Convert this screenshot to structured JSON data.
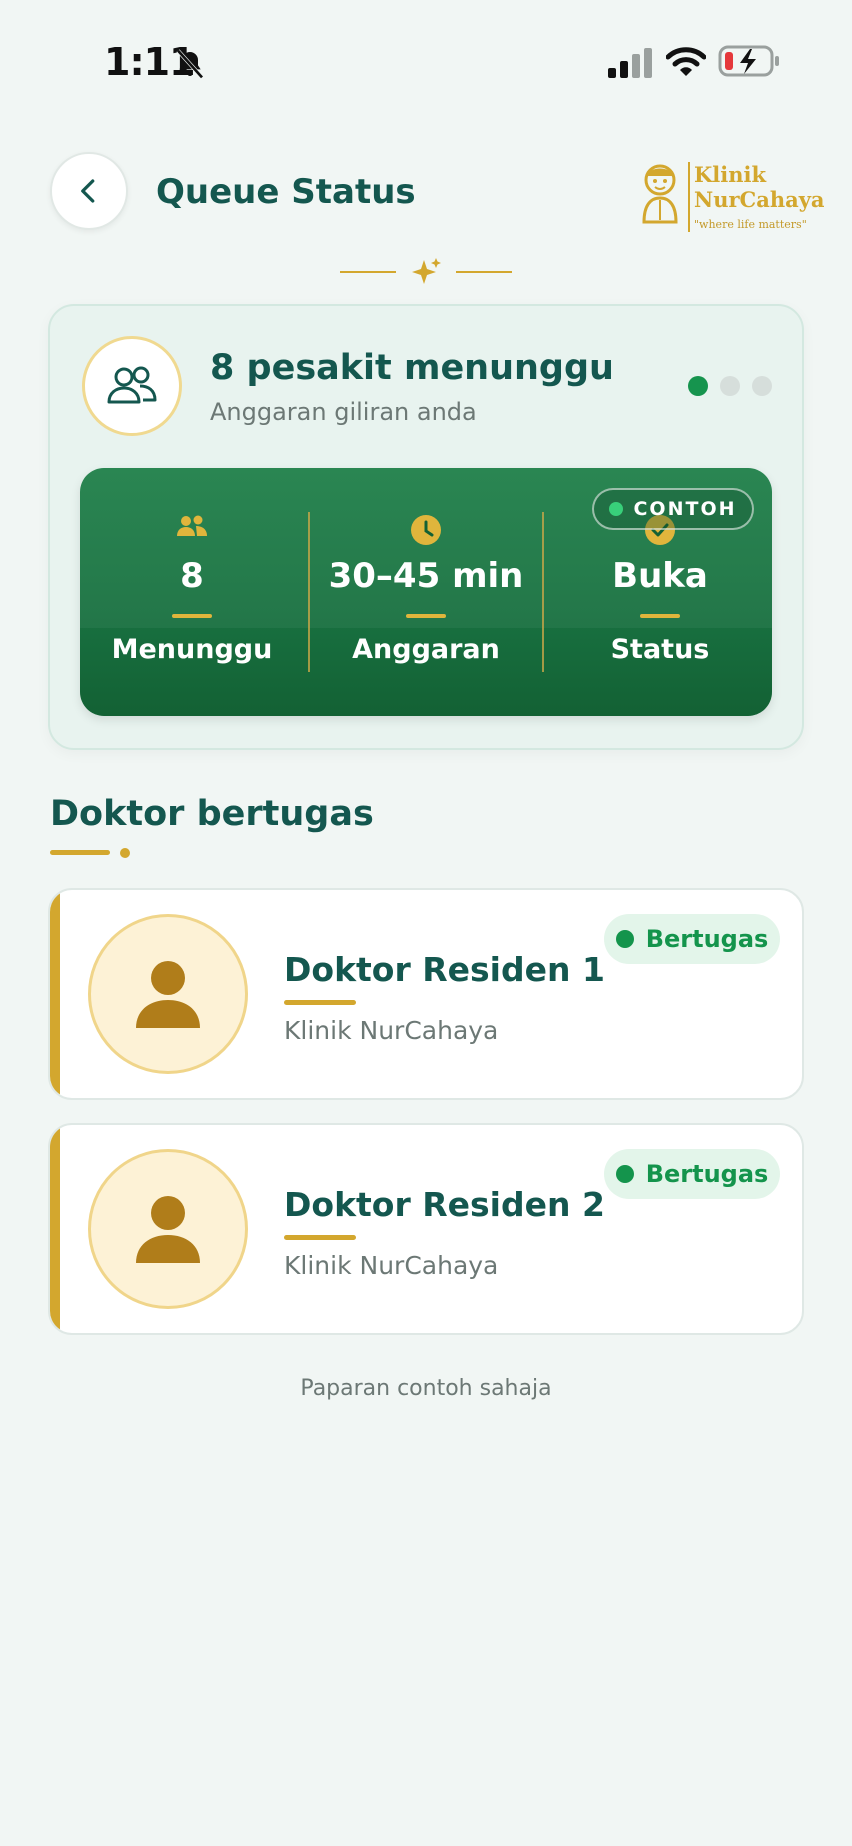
{
  "status_bar": {
    "time": "1:11"
  },
  "header": {
    "title": "Queue Status",
    "logo": {
      "name_line1": "Klinik",
      "name_line2": "NurCahaya",
      "tagline": "\"where life matters\""
    }
  },
  "summary": {
    "title": "8 pesakit menunggu",
    "subtitle": "Anggaran giliran anda",
    "badge": "CONTOH",
    "stats": [
      {
        "value": "8",
        "label": "Menunggu",
        "icon": "people-icon"
      },
      {
        "value": "30–45 min",
        "label": "Anggaran",
        "icon": "clock-icon"
      },
      {
        "value": "Buka",
        "label": "Status",
        "icon": "check-icon"
      }
    ]
  },
  "doctors": {
    "section_title": "Doktor bertugas",
    "items": [
      {
        "name": "Doktor Residen 1",
        "clinic": "Klinik NurCahaya",
        "status": "Bertugas"
      },
      {
        "name": "Doktor Residen 2",
        "clinic": "Klinik NurCahaya",
        "status": "Bertugas"
      }
    ]
  },
  "footer_note": "Paparan contoh sahaja",
  "colors": {
    "primary": "#14574f",
    "accent_gold": "#d3a72e",
    "green": "#187040",
    "status_green": "#14944c"
  }
}
